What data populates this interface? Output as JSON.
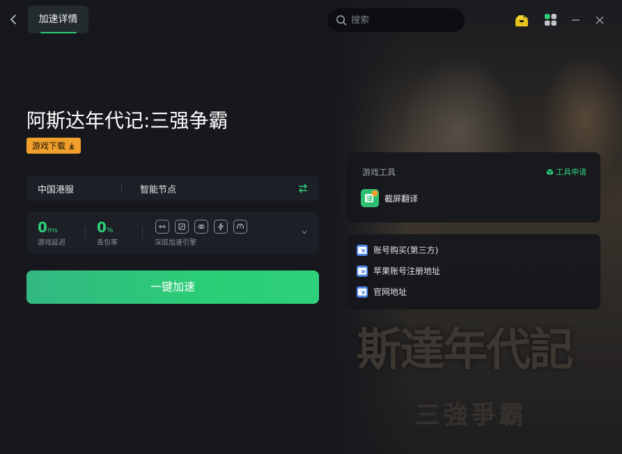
{
  "header": {
    "tab_label": "加速详情",
    "search_placeholder": "搜索"
  },
  "game": {
    "title": "阿斯达年代记:三强争霸",
    "download_label": "游戏下载",
    "background_title": "斯達年代記",
    "background_subtitle": "三強爭霸"
  },
  "server": {
    "region": "中国港服",
    "node": "智能节点"
  },
  "stats": {
    "latency_value": "0",
    "latency_unit": "ms",
    "latency_label": "游戏延迟",
    "loss_value": "0",
    "loss_unit": "%",
    "loss_label": "丢包率",
    "engine_label": "深层加速引擎"
  },
  "accelerate_button": "一键加速",
  "tools": {
    "title": "游戏工具",
    "apply_label": "工具申请",
    "items": [
      {
        "label": "截屏翻译"
      }
    ]
  },
  "links": [
    {
      "label": "账号购买(第三方)"
    },
    {
      "label": "苹果账号注册地址"
    },
    {
      "label": "官网地址"
    }
  ],
  "colors": {
    "accent": "#2ecf7a",
    "badge": "#f1a02c",
    "background": "#16181d"
  }
}
